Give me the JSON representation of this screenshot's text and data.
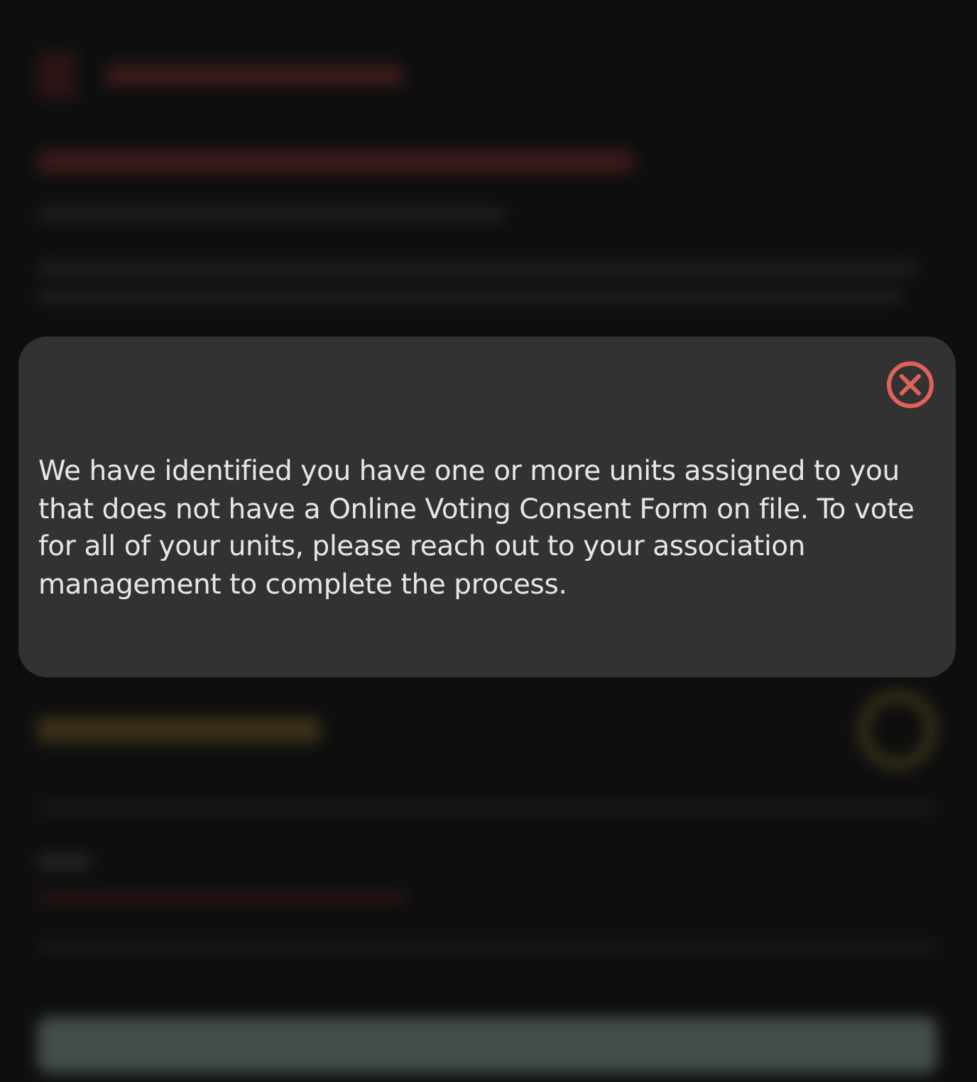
{
  "dialog": {
    "message": "We have identified you have one or more units assigned to you that does not have a Online Voting Consent Form on file. To vote for all of your units, please reach out to your association management to complete the process."
  }
}
